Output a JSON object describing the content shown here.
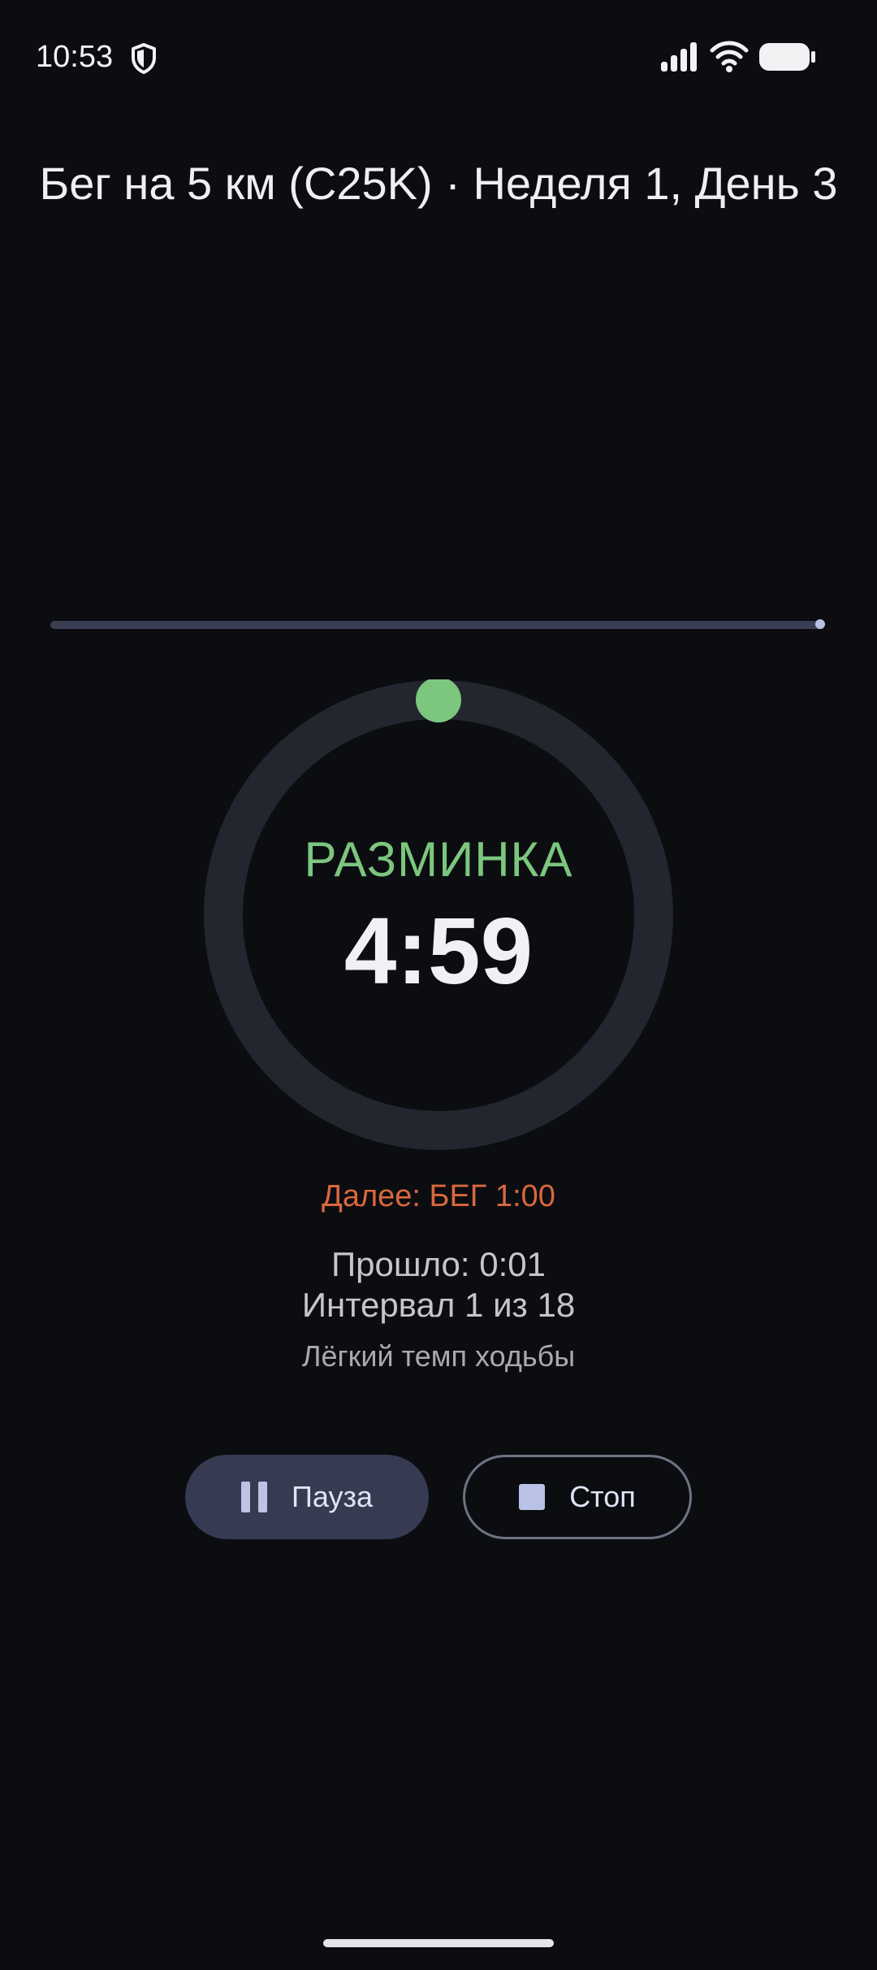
{
  "status_bar": {
    "time": "10:53",
    "icons": [
      "shield-icon",
      "signal-icon",
      "wifi-icon",
      "battery-icon"
    ]
  },
  "header": {
    "title": "Бег на 5 км (C25K) · Неделя 1, День 3"
  },
  "progress": {
    "fraction": 0.0
  },
  "workout": {
    "phase": "РАЗМИНКА",
    "timer": "4:59",
    "ring_progress": 0.0,
    "next_label": "Далее: БЕГ 1:00",
    "elapsed_label": "Прошло: 0:01",
    "interval_label": "Интервал 1 из 18",
    "hint": "Лёгкий темп ходьбы"
  },
  "controls": {
    "pause_label": "Пауза",
    "stop_label": "Стоп"
  },
  "colors": {
    "background": "#0c0d11",
    "accent_green": "#7cc67e",
    "next_orange": "#d9683f",
    "ring_track": "#23252f",
    "button_fill": "#363b52"
  }
}
